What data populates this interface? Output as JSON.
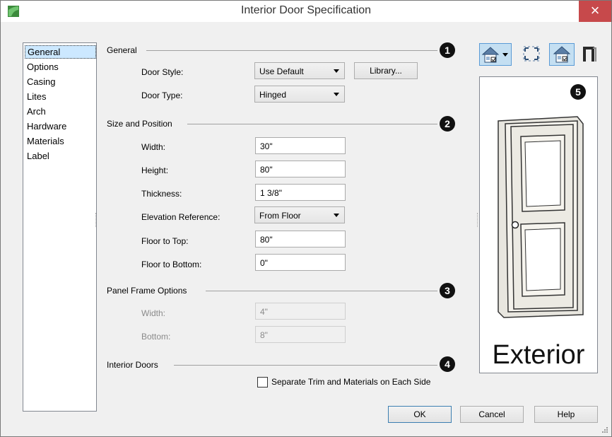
{
  "window": {
    "title": "Interior Door Specification"
  },
  "sidebar": {
    "items": [
      {
        "label": "General"
      },
      {
        "label": "Options"
      },
      {
        "label": "Casing"
      },
      {
        "label": "Lites"
      },
      {
        "label": "Arch"
      },
      {
        "label": "Hardware"
      },
      {
        "label": "Materials"
      },
      {
        "label": "Label"
      }
    ],
    "selected": "General"
  },
  "general": {
    "heading": "General",
    "marker": "1",
    "door_style_label": "Door Style:",
    "door_style_value": "Use Default",
    "library_button": "Library...",
    "door_type_label": "Door Type:",
    "door_type_value": "Hinged"
  },
  "size_position": {
    "heading": "Size and Position",
    "marker": "2",
    "width_label": "Width:",
    "width_value": "30\"",
    "height_label": "Height:",
    "height_value": "80\"",
    "thickness_label": "Thickness:",
    "thickness_value": "1 3/8\"",
    "elevation_label": "Elevation Reference:",
    "elevation_value": "From Floor",
    "floor_top_label": "Floor to Top:",
    "floor_top_value": "80\"",
    "floor_bottom_label": "Floor to Bottom:",
    "floor_bottom_value": "0\""
  },
  "panel_frame": {
    "heading": "Panel Frame Options",
    "marker": "3",
    "width_label": "Width:",
    "width_value": "4\"",
    "bottom_label": "Bottom:",
    "bottom_value": "8\""
  },
  "interior_doors": {
    "heading": "Interior Doors",
    "marker": "4",
    "checkbox_label": "Separate Trim and Materials on Each Side",
    "checked": false
  },
  "preview": {
    "marker": "5",
    "caption": "Exterior",
    "tools": [
      "view-type-icon",
      "fill-window-icon",
      "color-toggle-icon",
      "casing-toggle-icon"
    ]
  },
  "buttons": {
    "ok": "OK",
    "cancel": "Cancel",
    "help": "Help"
  },
  "colors": {
    "close": "#c7494b",
    "selection": "#cce8ff",
    "pressed_tool": "#c4dff2"
  }
}
